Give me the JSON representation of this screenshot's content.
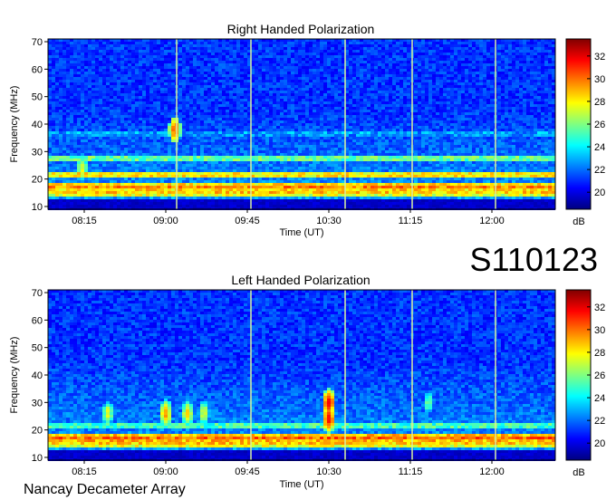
{
  "figure_id": "S110123",
  "footer": "Nancay Decameter Array",
  "colorbar_unit": "dB",
  "colorscale": [
    "#00007f",
    "#0000ff",
    "#0080ff",
    "#00ffff",
    "#80ff80",
    "#ffff00",
    "#ff8000",
    "#ff0000",
    "#7f0000"
  ],
  "chart_data": [
    {
      "type": "heatmap",
      "title": "Right Handed Polarization",
      "xlabel": "Time (UT)",
      "ylabel": "Frequency (MHz)",
      "x_ticks": [
        "08:15",
        "09:00",
        "09:45",
        "10:30",
        "11:15",
        "12:00"
      ],
      "x_tick_minutes": [
        495,
        540,
        585,
        630,
        675,
        720
      ],
      "xlim_minutes": [
        475,
        755
      ],
      "y_ticks": [
        10,
        20,
        30,
        40,
        50,
        60,
        70
      ],
      "ylim": [
        9,
        71
      ],
      "colorbar": {
        "ticks": [
          20,
          22,
          24,
          26,
          28,
          30,
          32
        ],
        "range": [
          18.5,
          33.5
        ],
        "label": "dB"
      },
      "bands": [
        {
          "freq": 36.5,
          "level": 24.5
        },
        {
          "freq": 27.5,
          "level": 27.5
        },
        {
          "freq": 21.5,
          "level": 30
        },
        {
          "freq": 17.0,
          "level": 31
        },
        {
          "freq": 15.0,
          "level": 30
        }
      ],
      "vertical_lines_minutes": [
        546,
        587,
        639,
        676,
        722
      ],
      "bursts": [
        {
          "time_minutes": 494,
          "freq": 24,
          "level": 28
        },
        {
          "time_minutes": 545,
          "freq": 38,
          "level": 31
        }
      ]
    },
    {
      "type": "heatmap",
      "title": "Left Handed Polarization",
      "xlabel": "Time (UT)",
      "ylabel": "Frequency (MHz)",
      "x_ticks": [
        "08:15",
        "09:00",
        "09:45",
        "10:30",
        "11:15",
        "12:00"
      ],
      "x_tick_minutes": [
        495,
        540,
        585,
        630,
        675,
        720
      ],
      "xlim_minutes": [
        475,
        755
      ],
      "y_ticks": [
        10,
        20,
        30,
        40,
        50,
        60,
        70
      ],
      "ylim": [
        9,
        71
      ],
      "colorbar": {
        "ticks": [
          20,
          22,
          24,
          26,
          28,
          30,
          32
        ],
        "range": [
          18.5,
          33.5
        ],
        "label": "dB"
      },
      "bands": [
        {
          "freq": 21.5,
          "level": 27
        },
        {
          "freq": 17.0,
          "level": 31.5
        },
        {
          "freq": 15.0,
          "level": 30
        }
      ],
      "vertical_lines_minutes": [
        587,
        639,
        676,
        722
      ],
      "bursts": [
        {
          "time_minutes": 508,
          "freq": 26,
          "level": 28
        },
        {
          "time_minutes": 540,
          "freq": 26,
          "level": 30
        },
        {
          "time_minutes": 552,
          "freq": 26,
          "level": 29
        },
        {
          "time_minutes": 561,
          "freq": 26,
          "level": 28
        },
        {
          "time_minutes": 630,
          "freq": 30,
          "level": 32
        },
        {
          "time_minutes": 630,
          "freq": 24,
          "level": 32
        },
        {
          "time_minutes": 685,
          "freq": 30,
          "level": 26.5
        }
      ]
    }
  ]
}
